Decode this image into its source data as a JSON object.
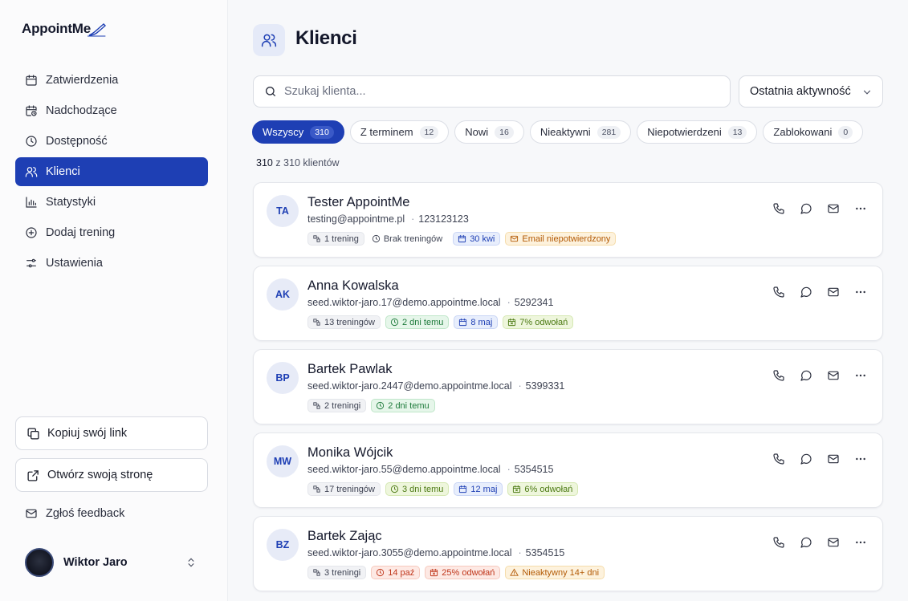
{
  "app": {
    "name": "AppointMe"
  },
  "sidebar": {
    "items": [
      {
        "label": "Zatwierdzenia",
        "icon": "calendar-icon"
      },
      {
        "label": "Nadchodzące",
        "icon": "calendar-clock-icon"
      },
      {
        "label": "Dostępność",
        "icon": "clock-icon"
      },
      {
        "label": "Klienci",
        "icon": "users-icon",
        "active": true
      },
      {
        "label": "Statystyki",
        "icon": "bar-chart-icon"
      },
      {
        "label": "Dodaj trening",
        "icon": "plus-circle-icon"
      },
      {
        "label": "Ustawienia",
        "icon": "sliders-icon"
      }
    ],
    "copy_link": "Kopiuj swój link",
    "open_page": "Otwórz swoją stronę",
    "feedback": "Zgłoś feedback",
    "user": {
      "name": "Wiktor Jaro"
    }
  },
  "main": {
    "title": "Klienci",
    "search_placeholder": "Szukaj klienta...",
    "sort_label": "Ostatnia aktywność",
    "tabs": [
      {
        "label": "Wszyscy",
        "count": "310",
        "active": true
      },
      {
        "label": "Z terminem",
        "count": "12"
      },
      {
        "label": "Nowi",
        "count": "16"
      },
      {
        "label": "Nieaktywni",
        "count": "281"
      },
      {
        "label": "Niepotwierdzeni",
        "count": "13"
      },
      {
        "label": "Zablokowani",
        "count": "0"
      }
    ],
    "count_shown": "310",
    "count_rest": " z 310 klientów",
    "clients": [
      {
        "initials": "TA",
        "name": "Tester AppointMe",
        "email": "testing@appointme.pl",
        "phone": "123123123",
        "tags": [
          {
            "text": "1 trening",
            "style": "gray",
            "icon": "trainings-icon"
          },
          {
            "text": "Brak treningów",
            "style": "plain",
            "icon": "clock-icon"
          },
          {
            "text": "30 kwi",
            "style": "blue",
            "icon": "calendar-icon"
          },
          {
            "text": "Email niepotwierdzony",
            "style": "orange",
            "icon": "mail-icon"
          }
        ]
      },
      {
        "initials": "AK",
        "name": "Anna Kowalska",
        "email": "seed.wiktor-jaro.17@demo.appointme.local",
        "phone": "5292341",
        "tags": [
          {
            "text": "13 treningów",
            "style": "gray",
            "icon": "trainings-icon"
          },
          {
            "text": "2 dni temu",
            "style": "green",
            "icon": "clock-icon"
          },
          {
            "text": "8 maj",
            "style": "blue",
            "icon": "calendar-icon"
          },
          {
            "text": "7% odwołań",
            "style": "lime",
            "icon": "calendar-x-icon"
          }
        ]
      },
      {
        "initials": "BP",
        "name": "Bartek Pawlak",
        "email": "seed.wiktor-jaro.2447@demo.appointme.local",
        "phone": "5399331",
        "tags": [
          {
            "text": "2 treningi",
            "style": "gray",
            "icon": "trainings-icon"
          },
          {
            "text": "2 dni temu",
            "style": "green",
            "icon": "clock-icon"
          }
        ]
      },
      {
        "initials": "MW",
        "name": "Monika Wójcik",
        "email": "seed.wiktor-jaro.55@demo.appointme.local",
        "phone": "5354515",
        "tags": [
          {
            "text": "17 treningów",
            "style": "gray",
            "icon": "trainings-icon"
          },
          {
            "text": "3 dni temu",
            "style": "lime",
            "icon": "clock-icon"
          },
          {
            "text": "12 maj",
            "style": "blue",
            "icon": "calendar-icon"
          },
          {
            "text": "6% odwołań",
            "style": "lime",
            "icon": "calendar-x-icon"
          }
        ]
      },
      {
        "initials": "BZ",
        "name": "Bartek Zając",
        "email": "seed.wiktor-jaro.3055@demo.appointme.local",
        "phone": "5354515",
        "tags": [
          {
            "text": "3 treningi",
            "style": "gray",
            "icon": "trainings-icon"
          },
          {
            "text": "14 paź",
            "style": "red",
            "icon": "clock-icon"
          },
          {
            "text": "25% odwołań",
            "style": "red",
            "icon": "calendar-x-icon"
          },
          {
            "text": "Nieaktywny 14+ dni",
            "style": "orange",
            "icon": "alert-icon"
          }
        ]
      }
    ]
  }
}
